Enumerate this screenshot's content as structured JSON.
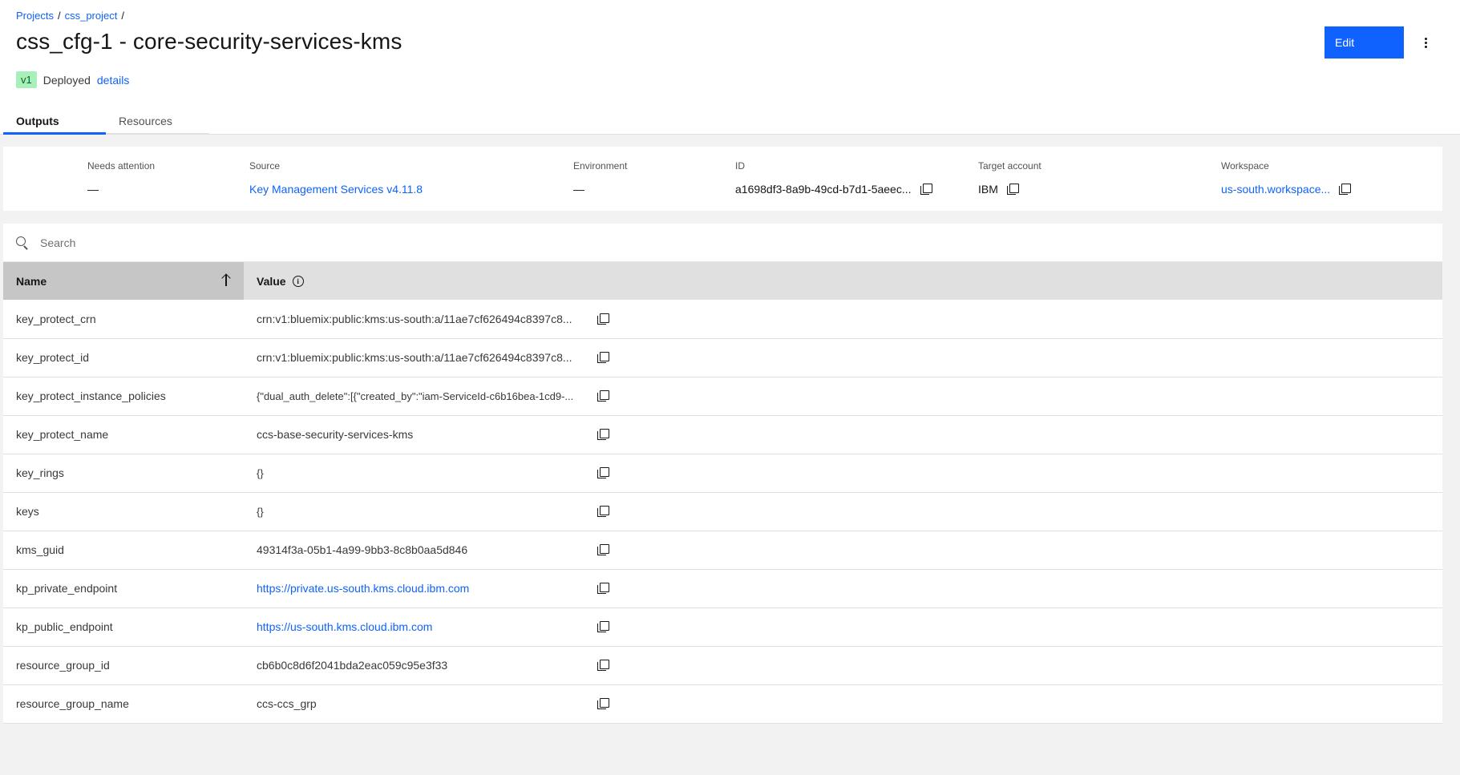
{
  "breadcrumb": {
    "items": [
      "Projects",
      "css_project"
    ],
    "separator": "/"
  },
  "header": {
    "title": "css_cfg-1 - core-security-services-kms",
    "version_badge": "v1",
    "status": "Deployed",
    "details_link": "details",
    "edit_label": "Edit",
    "overflow_icon": "overflow-menu-vertical-icon"
  },
  "tabs": [
    {
      "label": "Outputs",
      "active": true
    },
    {
      "label": "Resources",
      "active": false
    }
  ],
  "summary": {
    "needs_attention": {
      "label": "Needs attention",
      "value": "—"
    },
    "source": {
      "label": "Source",
      "value": "Key Management Services v4.11.8"
    },
    "environment": {
      "label": "Environment",
      "value": "—"
    },
    "id": {
      "label": "ID",
      "value": "a1698df3-8a9b-49cd-b7d1-5aeec..."
    },
    "target_account": {
      "label": "Target account",
      "value": "IBM"
    },
    "workspace": {
      "label": "Workspace",
      "value": "us-south.workspace..."
    }
  },
  "search": {
    "placeholder": "Search"
  },
  "table": {
    "columns": [
      "Name",
      "Value"
    ],
    "rows": [
      {
        "name": "key_protect_crn",
        "value": "crn:v1:bluemix:public:kms:us-south:a/11ae7cf626494c8397c8..."
      },
      {
        "name": "key_protect_id",
        "value": "crn:v1:bluemix:public:kms:us-south:a/11ae7cf626494c8397c8..."
      },
      {
        "name": "key_protect_instance_policies",
        "value": "{\"dual_auth_delete\":[{\"created_by\":\"iam-ServiceId-c6b16bea-1cd9-..."
      },
      {
        "name": "key_protect_name",
        "value": "ccs-base-security-services-kms"
      },
      {
        "name": "key_rings",
        "value": "{}"
      },
      {
        "name": "keys",
        "value": "{}"
      },
      {
        "name": "kms_guid",
        "value": "49314f3a-05b1-4a99-9bb3-8c8b0aa5d846"
      },
      {
        "name": "kp_private_endpoint",
        "value": "https://private.us-south.kms.cloud.ibm.com"
      },
      {
        "name": "kp_public_endpoint",
        "value": "https://us-south.kms.cloud.ibm.com"
      },
      {
        "name": "resource_group_id",
        "value": "cb6b0c8d6f2041bda2eac059c95e3f33"
      },
      {
        "name": "resource_group_name",
        "value": "ccs-ccs_grp"
      }
    ]
  },
  "colors": {
    "primary": "#0f62fe",
    "badge_bg": "#a7f0ba",
    "badge_text": "#0e6027",
    "page_bg": "#f2f2f2"
  }
}
